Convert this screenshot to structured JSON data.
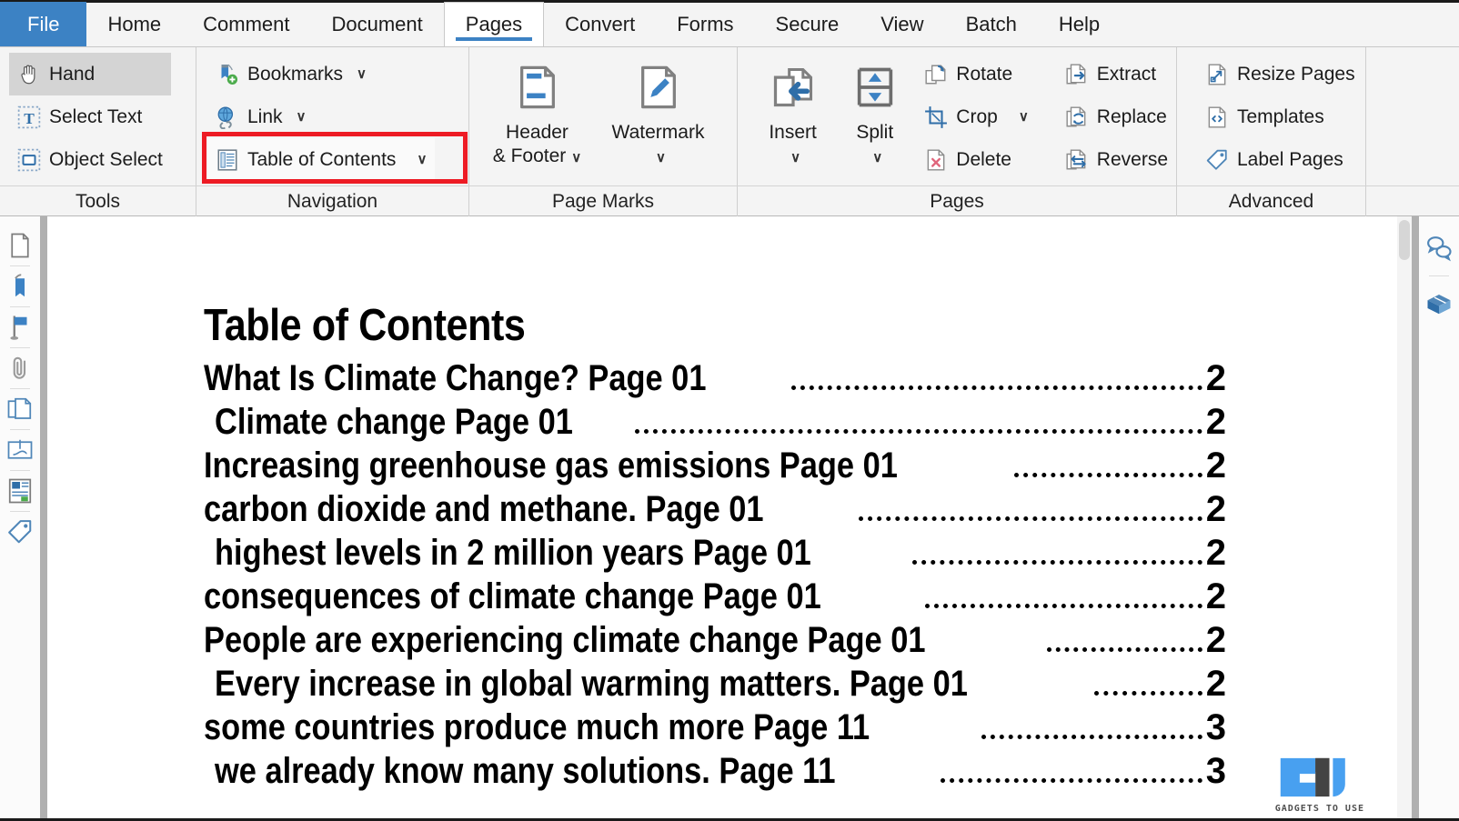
{
  "window": {
    "tabs": [
      {
        "label": "File",
        "style": "file"
      },
      {
        "label": "Home",
        "style": "normal"
      },
      {
        "label": "Comment",
        "style": "normal"
      },
      {
        "label": "Document",
        "style": "normal"
      },
      {
        "label": "Pages",
        "style": "active"
      },
      {
        "label": "Convert",
        "style": "normal"
      },
      {
        "label": "Forms",
        "style": "normal"
      },
      {
        "label": "Secure",
        "style": "normal"
      },
      {
        "label": "View",
        "style": "normal"
      },
      {
        "label": "Batch",
        "style": "normal"
      },
      {
        "label": "Help",
        "style": "normal"
      }
    ]
  },
  "ribbon": {
    "groups": [
      {
        "name": "Tools",
        "label": "Tools",
        "items": [
          {
            "label": "Hand",
            "icon": "hand-icon",
            "selected": true,
            "caret": false
          },
          {
            "label": "Select Text",
            "icon": "select-text-icon",
            "selected": false,
            "caret": false
          },
          {
            "label": "Object Select",
            "icon": "object-select-icon",
            "selected": false,
            "caret": false
          }
        ]
      },
      {
        "name": "Navigation",
        "label": "Navigation",
        "items": [
          {
            "label": "Bookmarks",
            "icon": "bookmarks-icon",
            "selected": false,
            "caret": true
          },
          {
            "label": "Link",
            "icon": "link-icon",
            "selected": false,
            "caret": true
          },
          {
            "label": "Table of Contents",
            "icon": "table-of-contents-icon",
            "selected": false,
            "caret": true,
            "highlighted": true
          }
        ]
      },
      {
        "name": "Page Marks",
        "label": "Page Marks",
        "big": [
          {
            "label": "Header\n& Footer",
            "line1": "Header",
            "line2": "& Footer",
            "icon": "header-footer-icon",
            "caret": true
          },
          {
            "label": "Watermark",
            "line1": "Watermark",
            "line2": "",
            "icon": "watermark-icon",
            "caret": true
          }
        ]
      },
      {
        "name": "Pages",
        "label": "Pages",
        "big": [
          {
            "label": "Insert",
            "line1": "Insert",
            "line2": "",
            "icon": "insert-page-icon",
            "caret": true
          },
          {
            "label": "Split",
            "line1": "Split",
            "line2": "",
            "icon": "split-page-icon",
            "caret": true
          }
        ],
        "colA": [
          {
            "label": "Rotate",
            "icon": "rotate-icon",
            "caret": false
          },
          {
            "label": "Crop",
            "icon": "crop-icon",
            "caret": true
          },
          {
            "label": "Delete",
            "icon": "delete-page-icon",
            "caret": false
          }
        ],
        "colB": [
          {
            "label": "Extract",
            "icon": "extract-icon",
            "caret": false
          },
          {
            "label": "Replace",
            "icon": "replace-icon",
            "caret": false
          },
          {
            "label": "Reverse",
            "icon": "reverse-icon",
            "caret": false
          }
        ]
      },
      {
        "name": "Advanced",
        "label": "Advanced",
        "items": [
          {
            "label": "Resize Pages",
            "icon": "resize-pages-icon",
            "caret": false
          },
          {
            "label": "Templates",
            "icon": "templates-icon",
            "caret": false
          },
          {
            "label": "Label Pages",
            "icon": "label-pages-icon",
            "caret": false
          }
        ]
      }
    ],
    "accent_color": "#3c82c4",
    "highlight_color": "#ed1b24"
  },
  "left_rail": {
    "icons": [
      "page-thumbnail-icon",
      "bookmark-icon",
      "flag-icon",
      "attachment-icon",
      "pages-panel-icon",
      "signature-icon",
      "text-fields-icon",
      "tag-icon"
    ]
  },
  "right_rail": {
    "icons": [
      "comments-icon",
      "library-icon"
    ]
  },
  "document": {
    "title": "Table of Contents",
    "entries": [
      {
        "text": "What Is Climate Change? Page 01",
        "page": "2",
        "indent": 0
      },
      {
        "text": "Climate change  Page 01",
        "page": "2",
        "indent": 1
      },
      {
        "text": "Increasing greenhouse gas emissions  Page 01",
        "page": "2",
        "indent": 0
      },
      {
        "text": "carbon dioxide and methane. Page 01",
        "page": "2",
        "indent": 0
      },
      {
        "text": "highest levels in 2 million years Page 01",
        "page": "2",
        "indent": 1
      },
      {
        "text": "consequences of climate change Page 01",
        "page": "2",
        "indent": 0
      },
      {
        "text": "People are experiencing climate change Page 01",
        "page": "2",
        "indent": 0
      },
      {
        "text": "Every increase in global warming matters. Page 01",
        "page": "2",
        "indent": 1
      },
      {
        "text": "some countries produce much more  Page 11",
        "page": "3",
        "indent": 0
      },
      {
        "text": "we already know many solutions. Page 11",
        "page": "3",
        "indent": 1
      }
    ]
  },
  "watermark": {
    "text": "GADGETS TO USE",
    "brand_color": "#3f9bf0"
  }
}
